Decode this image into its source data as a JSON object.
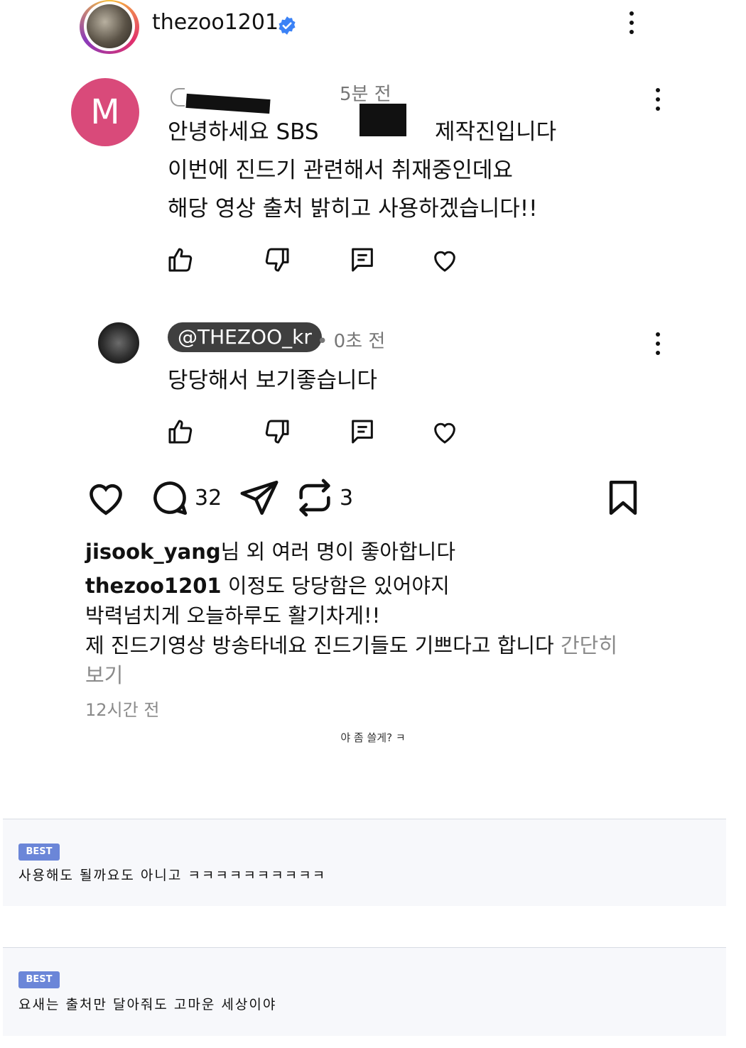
{
  "post": {
    "username": "thezoo1201"
  },
  "comment1": {
    "author_avatar_letter": "M",
    "time": "5분 전",
    "lines": [
      "안녕하세요 SBS",
      "제작진입니다",
      "이번에 진드기 관련해서 취재중인데요",
      "해당 영상 출처 밝히고 사용하겠습니다!!"
    ]
  },
  "reply": {
    "handle": "@THEZOO_kr",
    "time": "• 0초 전",
    "text": "당당해서 보기좋습니다"
  },
  "post_actions": {
    "comment_count": "32",
    "repost_count": "3"
  },
  "caption": {
    "likes_user": "jisook_yang",
    "likes_suffix": "님 외 여러 명이 좋아합니다",
    "author": "thezoo1201",
    "line1": " 이정도 당당함은 있어야지",
    "line2": "박력넘치게 오늘하루도 활기차게!!",
    "line3": "제 진드기영상 방송타네요 진드기들도 기쁘다고 합니다",
    "more_a": " 간단히",
    "more_b": "보기",
    "timestamp": "12시간 전"
  },
  "note": "야 좀 쓸게? ㅋ",
  "best_comments": [
    {
      "badge": "BEST",
      "text": "사용해도 될까요도 아니고 ㅋㅋㅋㅋㅋㅋㅋㅋㅋㅋ"
    },
    {
      "badge": "BEST",
      "text": "요새는 출처만 달아줘도 고마운 세상이야"
    }
  ],
  "colors": {
    "verified": "#3b82f6",
    "avatar_m": "#d94a7a",
    "best_badge": "#6b86d8",
    "handle_pill": "#3f3f3f"
  }
}
